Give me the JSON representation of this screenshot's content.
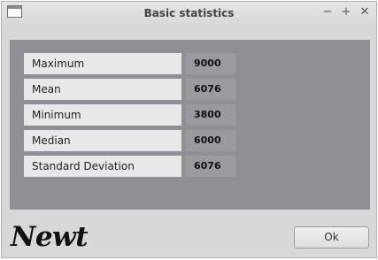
{
  "window": {
    "title": "Basic statistics",
    "controls": {
      "minimize": "−",
      "maximize": "+",
      "close": "✕"
    }
  },
  "stats": [
    {
      "label": "Maximum",
      "value": "9000"
    },
    {
      "label": "Mean",
      "value": "6076"
    },
    {
      "label": "Minimum",
      "value": "3800"
    },
    {
      "label": "Median",
      "value": "6000"
    },
    {
      "label": "Standard Deviation",
      "value": "6076"
    }
  ],
  "logo_text": "Newt",
  "ok_label": "Ok",
  "icons": {
    "app": "window-icon"
  },
  "colors": {
    "panel": "#8f8f95",
    "label_bg": "#e8e8e8",
    "value_bg": "#9b9b9f"
  }
}
